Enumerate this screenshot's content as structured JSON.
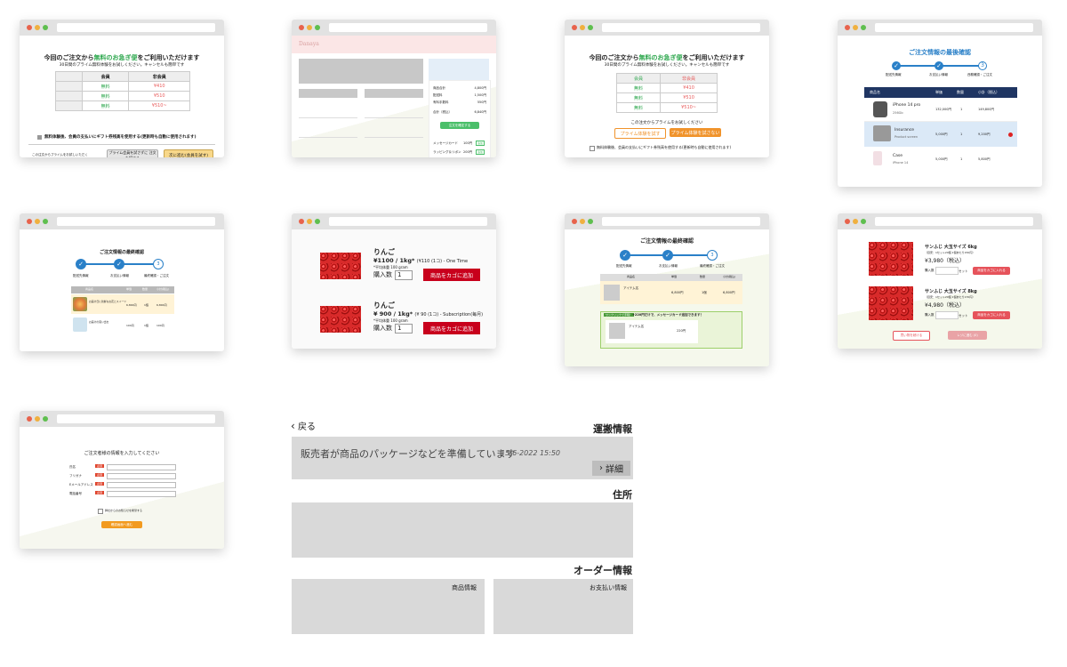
{
  "c1": {
    "headline_pre": "今回のご注文から",
    "headline_hl": "無料のお急ぎ便",
    "headline_post": "をご利用いただけます",
    "sub": "30日間のプライム無料体験をお試しください。キャンセルも簡単です",
    "col_member": "会員",
    "col_nonmember": "非会員",
    "rows": [
      {
        "member": "無料",
        "non": "¥410"
      },
      {
        "member": "無料",
        "non": "¥510"
      },
      {
        "member": "無料",
        "non": "¥510~"
      }
    ],
    "checkbox_label": "無料体験後、会員の支払いにギフト券残高を使用する(更新時も自動に使用されます)",
    "footer_text": "この注文からプライムをお試しいただく",
    "btn_trial": "プライム会員を試さずに 注文を続ける",
    "btn_next": "次に進む(会員を試す)"
  },
  "c2": {
    "brand": "Danaya",
    "sum_rows": [
      {
        "label": "商品合計",
        "value": "4,800円"
      },
      {
        "label": "配送料",
        "value": "1,500円"
      },
      {
        "label": "有料手数料",
        "value": "550円"
      },
      {
        "label": "合計（税込）",
        "value": "6,840円"
      }
    ],
    "btn_order": "注文を確定する",
    "opts": [
      {
        "label": "メッセージカード",
        "value": "100円",
        "tag": "追加"
      },
      {
        "label": "ラッピング＆リボン",
        "value": "200円",
        "tag": "追加"
      }
    ]
  },
  "c3": {
    "headline_pre": "今回のご注文から",
    "headline_hl": "無料のお急ぎ便",
    "headline_post": "をご利用いただけます",
    "sub": "30日間のプライム無料体験をお試しください。キャンセルも簡単です",
    "col_member": "会員",
    "col_nonmember": "非会員",
    "rows": [
      {
        "member": "無料",
        "non": "¥410"
      },
      {
        "member": "無料",
        "non": "¥510"
      },
      {
        "member": "無料",
        "non": "¥510~"
      }
    ],
    "footer_text": "この注文からプライムをお試しください",
    "btn_try": "プライム体験を試す",
    "btn_skip": "プライム体験を試さない",
    "checkbox_label": "無料体験後、会員の支払いにギフト券残高を使用する(更新時も自動に使用されます)"
  },
  "c4": {
    "title": "ご注文情報の最後確認",
    "steps": [
      "配送先情報",
      "お支払い情報",
      "西務確認・ご注文"
    ],
    "step3_num": "3",
    "cols": [
      "商品名",
      "単価",
      "数量",
      "小計（税込）"
    ],
    "items": [
      {
        "name": "iPhone 14 pro",
        "sub": "256Gb",
        "price": "132,000円",
        "qty": "1",
        "total": "149,800円"
      },
      {
        "name": "Insurance",
        "sub": "Product screen",
        "price": "5,000円",
        "qty": "1",
        "total": "9,200円"
      },
      {
        "name": "Case",
        "sub": "iPhone 14",
        "price": "5,000円",
        "qty": "1",
        "total": "5,800円"
      }
    ]
  },
  "c5": {
    "title": "ご注文情報の最終確認",
    "steps": [
      "配送先情報",
      "お支払い情報",
      "最終確認・ご注文"
    ],
    "step3_num": "3",
    "cols": [
      "商品名",
      "単価",
      "数量",
      "小計(税込)"
    ],
    "items": [
      {
        "name": "お届け日に新鮮なお花とスイーツ",
        "price": "6,800円",
        "qty": "1個",
        "total": "6,800円"
      },
      {
        "name": "お届けの思い出を",
        "price": "100円",
        "qty": "1個",
        "total": "100円"
      }
    ]
  },
  "c6": {
    "items": [
      {
        "name": "りんご",
        "price": "¥1100 / 1kg*",
        "note": "(¥110 (1コ) - One Time",
        "sub": "*平均体重 100 gram",
        "qty_label": "購入数",
        "qty": "1",
        "btn": "商品をカゴに追加"
      },
      {
        "name": "りんご",
        "price": "¥ 900 / 1kg*",
        "note": "(¥ 90 (1コ) - Subscription(毎月)",
        "sub": "*平均体重 100 gram",
        "qty_label": "購入数",
        "qty": "1",
        "btn": "商品をカゴに追加"
      }
    ]
  },
  "c7": {
    "title": "ご注文情報の最終確認",
    "steps": [
      "配送先情報",
      "お支払い情報",
      "最終確認・ご注文"
    ],
    "step3_num": "3",
    "cols": [
      "商品名",
      "単価",
      "数量",
      "小計(税込)"
    ],
    "item_name": "アイテム名",
    "item_price": "6,800円",
    "item_qty": "1個",
    "item_total": "6,800円",
    "promo_tag": "ワンクリックで手軽！",
    "promo_text": "+220円だけで、メッセージカード追加できます！",
    "promo_item": "アイテム名",
    "promo_price": "220円"
  },
  "c8": {
    "items": [
      {
        "name": "サンふじ 大玉サイズ 6kg",
        "sub": "（目安：1セット20個 1個あたり150円）",
        "price": "¥3,980（税込）",
        "qty_label": "購入数",
        "unit": "セット",
        "btn": "商品をカゴに入れる"
      },
      {
        "name": "サンふじ 大玉サイズ 8kg",
        "sub": "（目安：1セット20個 1個あたり170円）",
        "price": "¥4,980（税込）",
        "qty_label": "購入数",
        "unit": "セット",
        "btn": "商品をカゴに入れる"
      }
    ],
    "btn_continue": "買い物を続ける",
    "btn_checkout": "レジに進む (0)"
  },
  "c9": {
    "title": "ご注文者様の情報を入力してください",
    "fields": [
      {
        "label": "氏名",
        "req": "必須"
      },
      {
        "label": "フリガナ",
        "req": "必須"
      },
      {
        "label": "Eメールアドレス",
        "req": "必須"
      },
      {
        "label": "電話番号",
        "req": "必須"
      }
    ],
    "checkbox_label": "弊社からのお知らせを希望する",
    "submit": "確認画面へ進む"
  },
  "order": {
    "back": "戻る",
    "shipping_title": "運搬情報",
    "status": "販売者が商品のパッケージなどを準備しています",
    "date": "15-6-2022 15:50",
    "detail": "詳細",
    "address_title": "住所",
    "order_title": "オーダー情報",
    "product_info": "商品情報",
    "payment_info": "お支払い情報"
  }
}
